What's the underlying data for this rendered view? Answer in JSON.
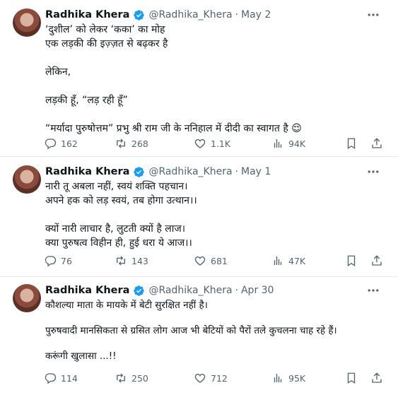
{
  "tweets": [
    {
      "name": "Radhika Khera",
      "handle": "@Radhika_Khera",
      "date": "May 2",
      "lines": [
        "‘दुशील’ को लेकर ‘कका’ का मोह",
        "एक लड़की की इज़्ज़त से बढ़कर है",
        "",
        "लेकिन,",
        "",
        "लड़की हूँ, “लड़ रही हूँ”",
        "",
        "“मर्यादा पुरुषोत्तम” प्रभु श्री राम जी के ननिहाल में दीदी का स्वागत है 😌"
      ],
      "replies": "162",
      "retweets": "268",
      "likes": "1.1K",
      "views": "94K"
    },
    {
      "name": "Radhika Khera",
      "handle": "@Radhika_Khera",
      "date": "May 1",
      "lines": [
        "नारी तू अबला नहीं, स्वयं शक्ति पहचान।",
        "अपने हक को लड़ स्वयं, तब होगा उत्थान।।",
        "",
        "क्यों नारी लाचार है, लुटती क्यों है लाज।",
        "क्या पुरुषत्व विहीन ही, हुई धरा ये आज।।"
      ],
      "replies": "76",
      "retweets": "143",
      "likes": "681",
      "views": "47K"
    },
    {
      "name": "Radhika Khera",
      "handle": "@Radhika_Khera",
      "date": "Apr 30",
      "lines": [
        "कौशल्या माता के मायके में बेटी सुरक्षित नहीं है।",
        "",
        "पुरुषवादी मानसिकता से ग्रसित लोग आज भी बेटियों को पैरों तले कुचलना चाह रहे हैं।",
        "",
        "करूंगी खुलासा ...!!"
      ],
      "replies": "114",
      "retweets": "250",
      "likes": "712",
      "views": "95K"
    }
  ],
  "colors": {
    "text": "#0f1419",
    "muted": "#536471",
    "verified": "#1d9bf0",
    "divider": "#e6e9ec"
  },
  "icons": [
    "verified-icon",
    "more-icon",
    "reply-icon",
    "retweet-icon",
    "like-icon",
    "views-icon",
    "bookmark-icon",
    "share-icon"
  ]
}
